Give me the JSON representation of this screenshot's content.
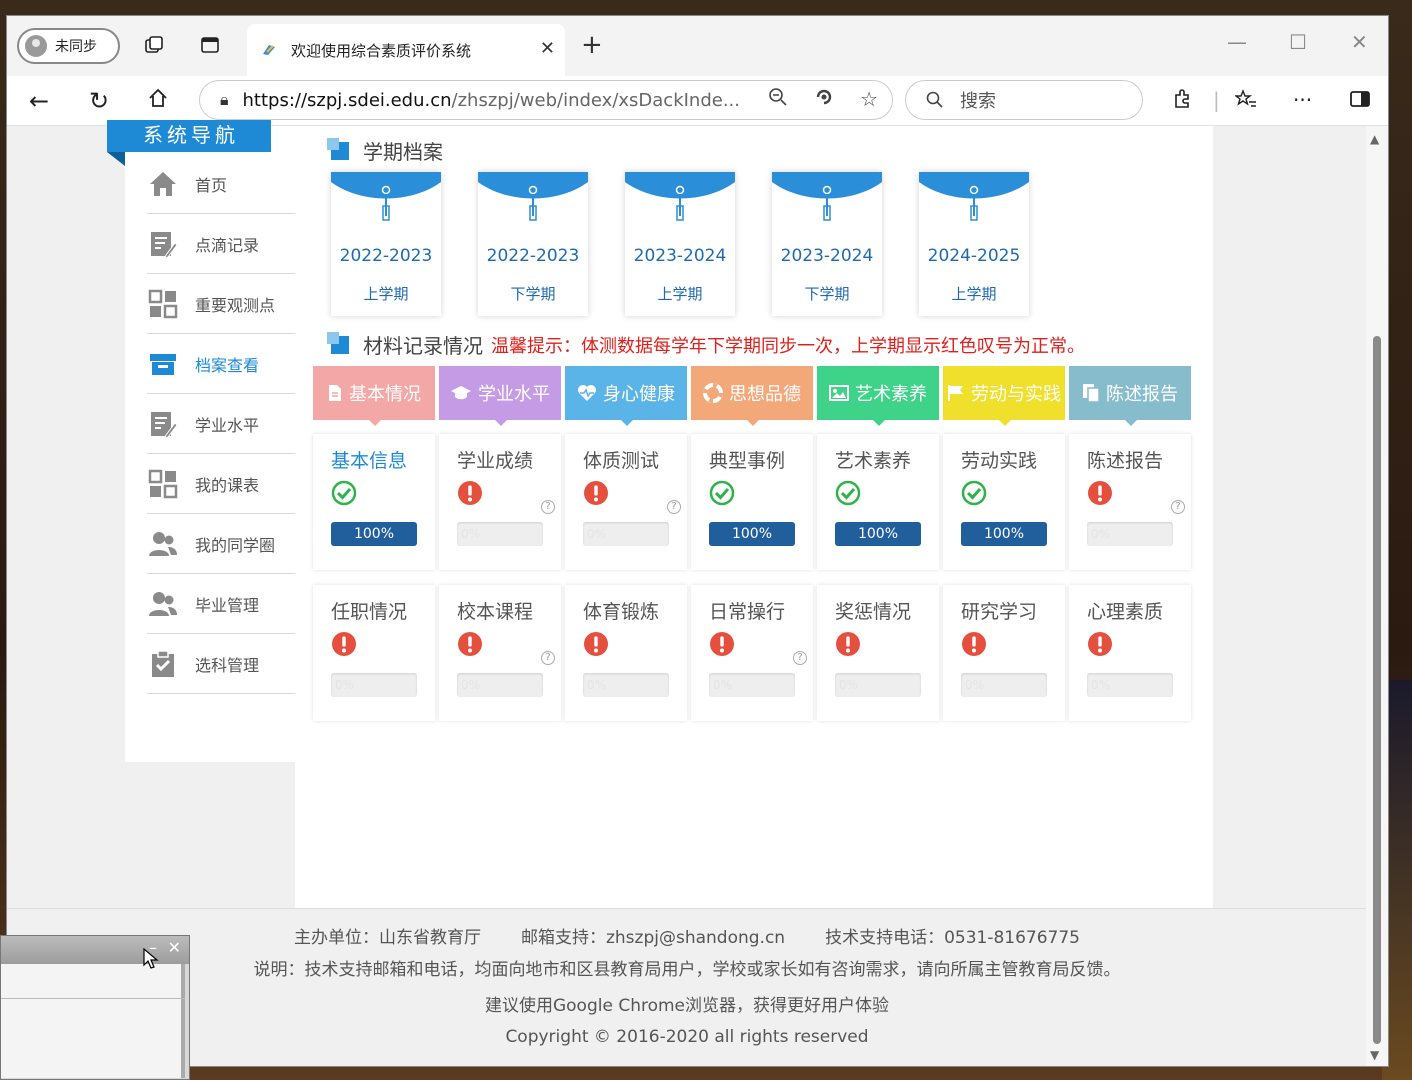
{
  "browser": {
    "profile_label": "未同步",
    "tab_title": "欢迎使用综合素质评价系统",
    "url_host": "https://szpj.sdei.edu.cn",
    "url_path": "/zhszpj/web/index/xsDackInde...",
    "search_placeholder": "搜索"
  },
  "sidebar": {
    "title": "系统导航",
    "items": [
      {
        "label": "首页",
        "icon": "home-icon"
      },
      {
        "label": "点滴记录",
        "icon": "edit-doc-icon"
      },
      {
        "label": "重要观测点",
        "icon": "exchange-icon"
      },
      {
        "label": "档案查看",
        "icon": "archive-box-icon",
        "active": true
      },
      {
        "label": "学业水平",
        "icon": "edit-doc-icon"
      },
      {
        "label": "我的课表",
        "icon": "exchange-icon"
      },
      {
        "label": "我的同学圈",
        "icon": "users-icon"
      },
      {
        "label": "毕业管理",
        "icon": "users-icon"
      },
      {
        "label": "选科管理",
        "icon": "clipboard-check-icon"
      }
    ]
  },
  "semester_section": {
    "title": "学期档案",
    "semesters": [
      {
        "year": "2022-2023",
        "term": "上学期"
      },
      {
        "year": "2022-2023",
        "term": "下学期"
      },
      {
        "year": "2023-2024",
        "term": "上学期"
      },
      {
        "year": "2023-2024",
        "term": "下学期"
      },
      {
        "year": "2024-2025",
        "term": "上学期"
      }
    ]
  },
  "material_section": {
    "title": "材料记录情况",
    "warning": "温馨提示：体测数据每学年下学期同步一次，上学期显示红色叹号为正常。"
  },
  "categories": [
    {
      "label": "基本情况",
      "color": "#f4a7a7",
      "icon": "file-icon"
    },
    {
      "label": "学业水平",
      "color": "#c59be6",
      "icon": "graduation-cap-icon"
    },
    {
      "label": "身心健康",
      "color": "#5ab4e8",
      "icon": "heartbeat-icon"
    },
    {
      "label": "思想品德",
      "color": "#f2a878",
      "icon": "lifebuoy-icon"
    },
    {
      "label": "艺术素养",
      "color": "#3fd38a",
      "icon": "image-icon"
    },
    {
      "label": "劳动与实践",
      "color": "#f0e02c",
      "icon": "flag-icon"
    },
    {
      "label": "陈述报告",
      "color": "#86bccc",
      "icon": "copy-icon"
    }
  ],
  "records": [
    {
      "title": "基本信息",
      "status": "ok",
      "progress": 100,
      "label": "100%",
      "help": false,
      "highlight": true
    },
    {
      "title": "学业成绩",
      "status": "warn",
      "progress": 0,
      "label": "0%",
      "help": true
    },
    {
      "title": "体质测试",
      "status": "warn",
      "progress": 0,
      "label": "0%",
      "help": true
    },
    {
      "title": "典型事例",
      "status": "ok",
      "progress": 100,
      "label": "100%",
      "help": false
    },
    {
      "title": "艺术素养",
      "status": "ok",
      "progress": 100,
      "label": "100%",
      "help": false
    },
    {
      "title": "劳动实践",
      "status": "ok",
      "progress": 100,
      "label": "100%",
      "help": false
    },
    {
      "title": "陈述报告",
      "status": "warn",
      "progress": 0,
      "label": "0%",
      "help": true
    },
    {
      "title": "任职情况",
      "status": "warn",
      "progress": 0,
      "label": "0%",
      "help": false
    },
    {
      "title": "校本课程",
      "status": "warn",
      "progress": 0,
      "label": "0%",
      "help": true
    },
    {
      "title": "体育锻炼",
      "status": "warn",
      "progress": 0,
      "label": "0%",
      "help": false
    },
    {
      "title": "日常操行",
      "status": "warn",
      "progress": 0,
      "label": "0%",
      "help": true
    },
    {
      "title": "奖惩情况",
      "status": "warn",
      "progress": 0,
      "label": "0%",
      "help": false
    },
    {
      "title": "研究学习",
      "status": "warn",
      "progress": 0,
      "label": "0%",
      "help": false
    },
    {
      "title": "心理素质",
      "status": "warn",
      "progress": 0,
      "label": "0%",
      "help": false
    }
  ],
  "footer": {
    "host": "主办单位：山东省教育厅",
    "email": "邮箱支持：zhszpj@shandong.cn",
    "phone": "技术支持电话：0531-81676775",
    "note": "说明：技术支持邮箱和电话，均面向地市和区县教育局用户，学校或家长如有咨询需求，请向所属主管教育局反馈。",
    "browser_tip": "建议使用Google Chrome浏览器，获得更好用户体验",
    "copyright": "Copyright © 2016-2020 all rights reserved"
  },
  "colors": {
    "accent": "#1e8ad6",
    "progress": "#215e9c",
    "ok": "#2db34a",
    "warn": "#e5503e",
    "warning_text": "#e0201c"
  }
}
